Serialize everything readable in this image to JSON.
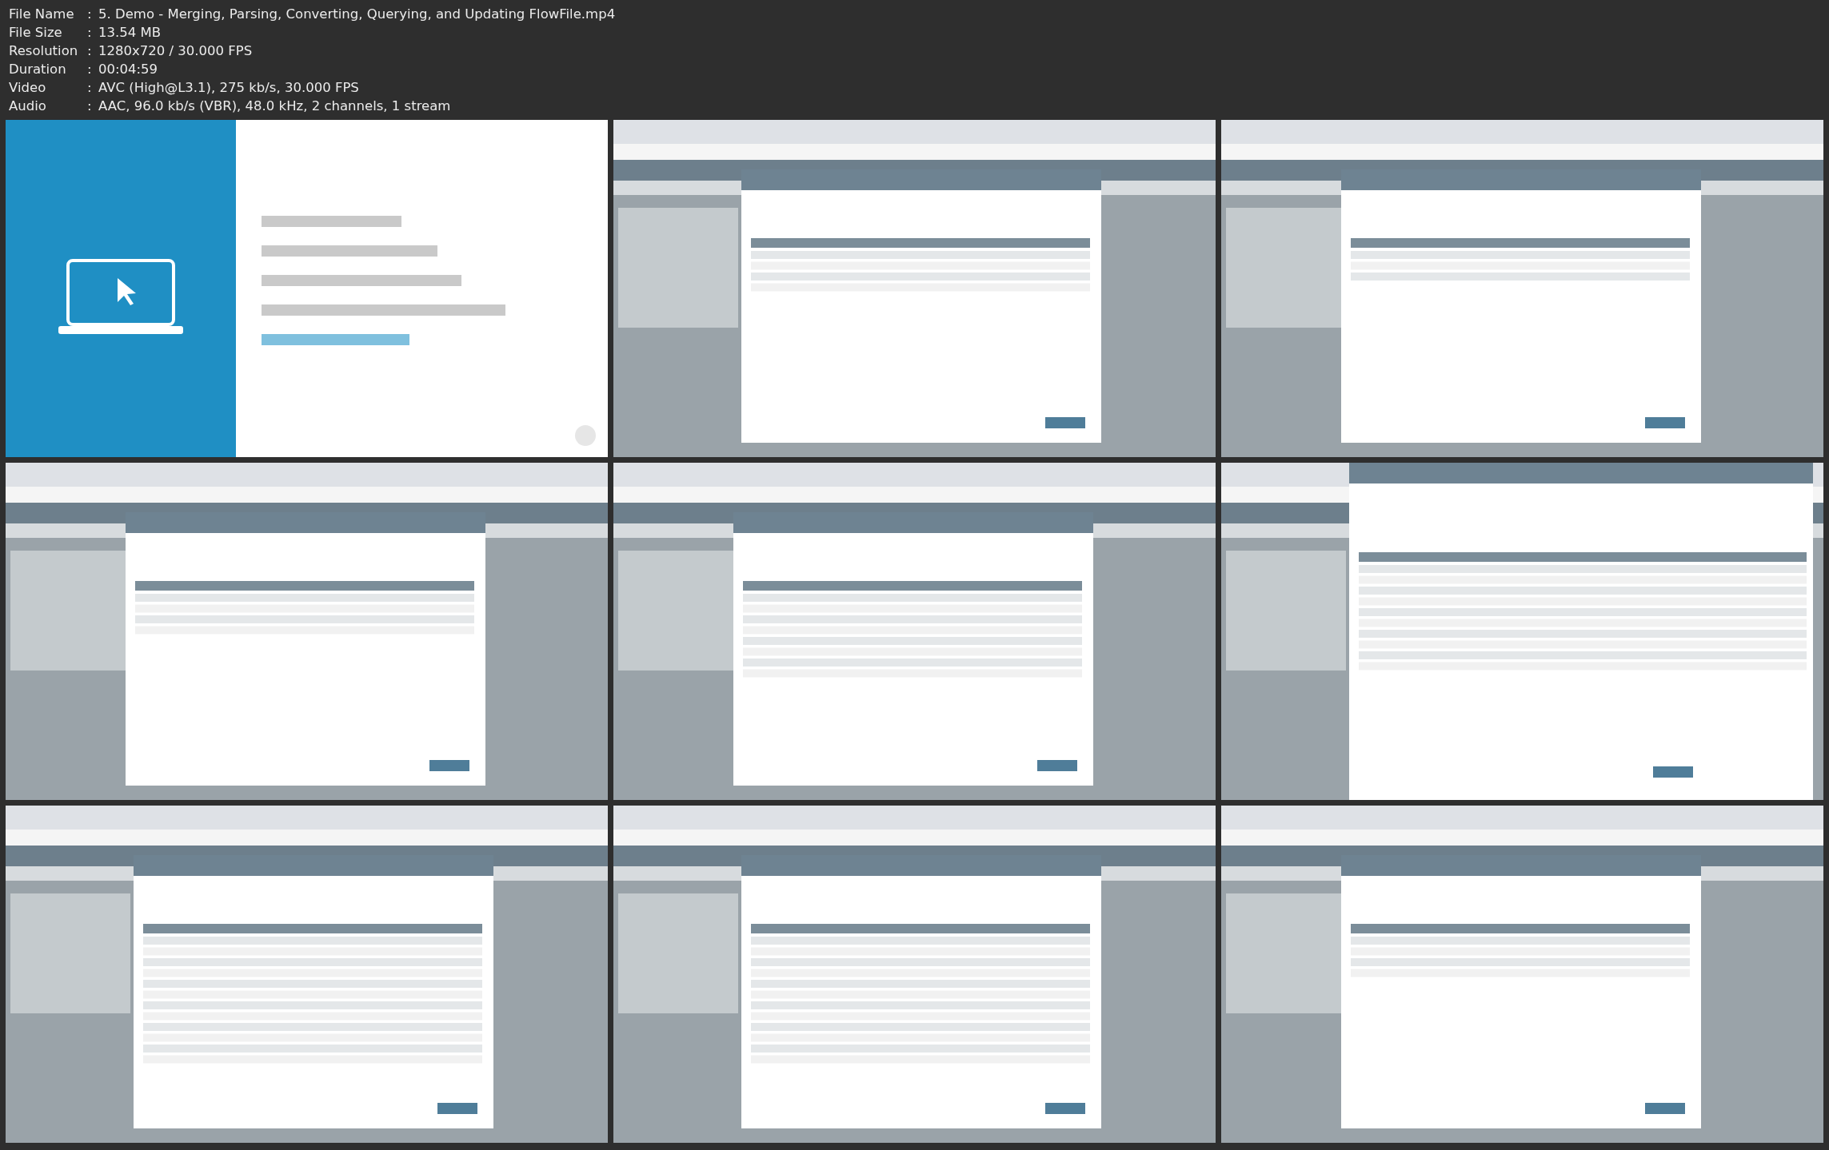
{
  "media_info": [
    {
      "label": "File Name",
      "separator": ":",
      "value": "5. Demo - Merging, Parsing, Converting, Querying, and Updating FlowFile.mp4"
    },
    {
      "label": "File Size",
      "separator": ":",
      "value": "13.54 MB"
    },
    {
      "label": "Resolution",
      "separator": ":",
      "value": "1280x720 / 30.000 FPS"
    },
    {
      "label": "Duration",
      "separator": ":",
      "value": "00:04:59"
    },
    {
      "label": "Video",
      "separator": ":",
      "value": "AVC (High@L3.1), 275 kb/s, 30.000 FPS"
    },
    {
      "label": "Audio",
      "separator": ":",
      "value": "AAC, 96.0 kb/s (VBR), 48.0 kHz, 2 channels, 1 stream"
    }
  ]
}
